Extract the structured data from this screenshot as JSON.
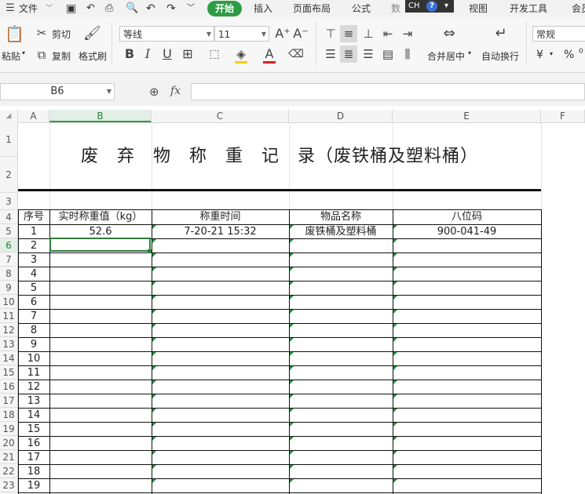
{
  "menubar": {
    "file": "文件",
    "tabs": [
      "开始",
      "插入",
      "页面布局",
      "公式",
      "视图",
      "开发工具",
      "会员"
    ],
    "active_tab": "开始",
    "ime": "CH"
  },
  "ribbon": {
    "paste": "粘贴",
    "cut": "剪切",
    "copy": "复制",
    "format_painter": "格式刷",
    "font_name": "等线",
    "font_size": "11",
    "merge_center": "合并居中",
    "wrap_text": "自动换行",
    "number_format": "常规",
    "currency_symbol": "¥",
    "percent_symbol": "%"
  },
  "formula_bar": {
    "name_box": "B6",
    "fx": "fx",
    "content": ""
  },
  "columns": [
    "A",
    "B",
    "C",
    "D",
    "E",
    "F"
  ],
  "active_column": "B",
  "rows": [
    "1",
    "2",
    "3",
    "4",
    "5",
    "6",
    "7",
    "8",
    "9",
    "10",
    "11",
    "12",
    "13",
    "14",
    "15",
    "16",
    "17",
    "18",
    "19",
    "20",
    "21",
    "22",
    "23"
  ],
  "active_row": "6",
  "sheet": {
    "title": "废　弃　物　称　重　记　录（废铁桶及塑料桶）",
    "headers": [
      "序号",
      "实时称重值（kg）",
      "称重时间",
      "物品名称",
      "八位码"
    ],
    "first_record": {
      "seq": "1",
      "weight": "52.6",
      "time": "7-20-21 15:32",
      "item": "废铁桶及塑料桶",
      "code": "900-041-49"
    },
    "seq_numbers": [
      "2",
      "3",
      "4",
      "5",
      "6",
      "7",
      "8",
      "9",
      "10",
      "11",
      "12",
      "13",
      "14",
      "15",
      "16",
      "17",
      "18",
      "19"
    ]
  }
}
